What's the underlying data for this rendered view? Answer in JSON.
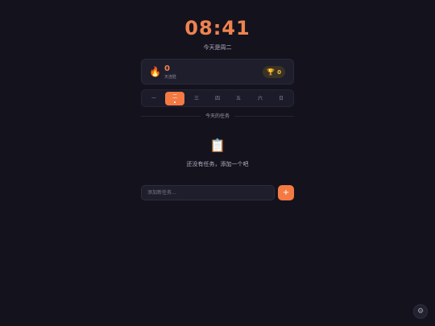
{
  "header": {
    "time": "08:41",
    "today_text": "今天是周二"
  },
  "streak": {
    "icon": "fire-icon",
    "count": "0",
    "label": "天连胜",
    "trophy_icon": "trophy-icon",
    "trophy_count": "0"
  },
  "week": {
    "days": [
      "一",
      "二",
      "三",
      "四",
      "五",
      "六",
      "日"
    ],
    "selected": "二"
  },
  "tasks": {
    "section_title": "今天的任务",
    "empty_icon": "clipboard-icon",
    "empty_text": "还没有任务，添加一个吧",
    "input_placeholder": "添加新任务...",
    "add_label": "+"
  },
  "settings": {
    "icon": "gear-icon"
  },
  "colors": {
    "accent": "#f47a44",
    "background": "#14131d",
    "card": "#1f1e2d",
    "trophy": "#f2c14e"
  }
}
